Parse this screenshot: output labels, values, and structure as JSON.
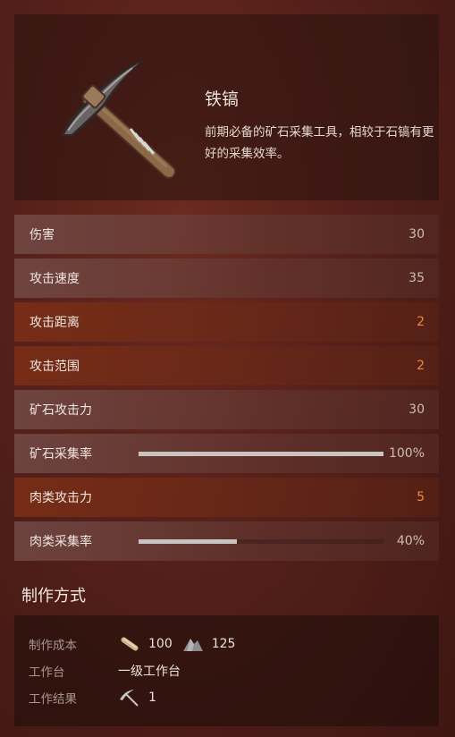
{
  "item": {
    "name": "铁镐",
    "description": "前期必备的矿石采集工具，相较于石镐有更好的采集效率。",
    "icon": "iron-pickaxe-icon"
  },
  "stats": [
    {
      "label": "伤害",
      "value": "30",
      "highlight": false
    },
    {
      "label": "攻击速度",
      "value": "35",
      "highlight": false
    },
    {
      "label": "攻击距离",
      "value": "2",
      "highlight": true
    },
    {
      "label": "攻击范围",
      "value": "2",
      "highlight": true
    },
    {
      "label": "矿石攻击力",
      "value": "30",
      "highlight": false
    },
    {
      "label": "矿石采集率",
      "value": "100%",
      "highlight": false,
      "bar_fraction": 1.0
    },
    {
      "label": "肉类攻击力",
      "value": "5",
      "highlight": true
    },
    {
      "label": "肉类采集率",
      "value": "40%",
      "highlight": false,
      "bar_fraction": 0.4
    }
  ],
  "colors": {
    "highlight_value": "#ef8a3c",
    "normal_value": "#cdbdb6"
  },
  "crafting": {
    "title": "制作方式",
    "cost_label": "制作成本",
    "workbench_label": "工作台",
    "result_label": "工作结果",
    "costs": [
      {
        "icon": "wood-log-icon",
        "amount": "100"
      },
      {
        "icon": "stone-icon",
        "amount": "125"
      }
    ],
    "workbench": "一级工作台",
    "result": {
      "icon": "pickaxe-icon",
      "amount": "1"
    }
  }
}
